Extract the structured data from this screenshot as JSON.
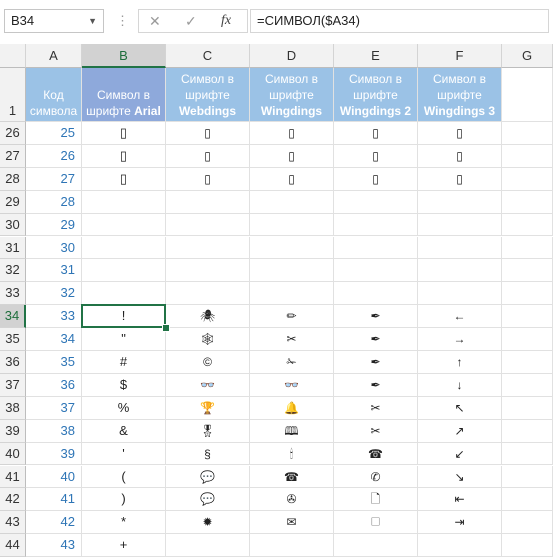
{
  "formula_bar": {
    "name_box": "B34",
    "cancel_icon": "✕",
    "enter_icon": "✓",
    "fx_label": "fx",
    "formula": "=СИМВОЛ($A34)"
  },
  "columns": [
    "A",
    "B",
    "C",
    "D",
    "E",
    "F",
    "G"
  ],
  "selected_column": "B",
  "header_row": {
    "row_num": "1",
    "a": [
      "Код",
      "символа"
    ],
    "b": [
      "Символ в",
      "шрифте Arial"
    ],
    "c": [
      "Символ в",
      "шрифте",
      "Webdings"
    ],
    "d": [
      "Символ в",
      "шрифте",
      "Wingdings"
    ],
    "e": [
      "Символ в",
      "шрифте",
      "Wingdings 2"
    ],
    "f": [
      "Символ в",
      "шрифте",
      "Wingdings 3"
    ]
  },
  "header_colors": {
    "a": "#9bc2e6",
    "b": "#8ea9db",
    "c": "#9bc2e6",
    "d": "#9bc2e6",
    "e": "#9bc2e6",
    "f": "#9bc2e6"
  },
  "rows": [
    {
      "n": "26",
      "a": "25",
      "b": "▯",
      "c": "▯",
      "d": "▯",
      "e": "▯",
      "f": "▯"
    },
    {
      "n": "27",
      "a": "26",
      "b": "▯",
      "c": "▯",
      "d": "▯",
      "e": "▯",
      "f": "▯"
    },
    {
      "n": "28",
      "a": "27",
      "b": "▯",
      "c": "▯",
      "d": "▯",
      "e": "▯",
      "f": "▯"
    },
    {
      "n": "29",
      "a": "28",
      "b": "",
      "c": "",
      "d": "",
      "e": "",
      "f": ""
    },
    {
      "n": "30",
      "a": "29",
      "b": "",
      "c": "",
      "d": "",
      "e": "",
      "f": ""
    },
    {
      "n": "31",
      "a": "30",
      "b": "",
      "c": "",
      "d": "",
      "e": "",
      "f": ""
    },
    {
      "n": "32",
      "a": "31",
      "b": "",
      "c": "",
      "d": "",
      "e": "",
      "f": ""
    },
    {
      "n": "33",
      "a": "32",
      "b": "",
      "c": "",
      "d": "",
      "e": "",
      "f": ""
    },
    {
      "n": "34",
      "a": "33",
      "b": "!",
      "c": "🕷",
      "d": "✏",
      "e": "✒",
      "f": "←"
    },
    {
      "n": "35",
      "a": "34",
      "b": "\"",
      "c": "🕸",
      "d": "✂",
      "e": "✒",
      "f": "→"
    },
    {
      "n": "36",
      "a": "35",
      "b": "#",
      "c": "©",
      "d": "✁",
      "e": "✒",
      "f": "↑"
    },
    {
      "n": "37",
      "a": "36",
      "b": "$",
      "c": "👓",
      "d": "👓",
      "e": "✒",
      "f": "↓"
    },
    {
      "n": "38",
      "a": "37",
      "b": "%",
      "c": "🏆",
      "d": "🔔",
      "e": "✂",
      "f": "↖"
    },
    {
      "n": "39",
      "a": "38",
      "b": "&",
      "c": "🎖",
      "d": "🕮",
      "e": "✂",
      "f": "↗"
    },
    {
      "n": "40",
      "a": "39",
      "b": "'",
      "c": "§",
      "d": "🕯",
      "e": "☎",
      "f": "↙"
    },
    {
      "n": "41",
      "a": "40",
      "b": "(",
      "c": "💬",
      "d": "☎",
      "e": "✆",
      "f": "↘"
    },
    {
      "n": "42",
      "a": "41",
      "b": ")",
      "c": "💬",
      "d": "✇",
      "e": "🗋",
      "f": "⇤"
    },
    {
      "n": "43",
      "a": "42",
      "b": "*",
      "c": "✹",
      "d": "✉",
      "e": "🗆",
      "f": "⇥"
    },
    {
      "n": "44",
      "a": "43",
      "b": "+",
      "c": "",
      "d": "",
      "e": "",
      "f": ""
    }
  ]
}
